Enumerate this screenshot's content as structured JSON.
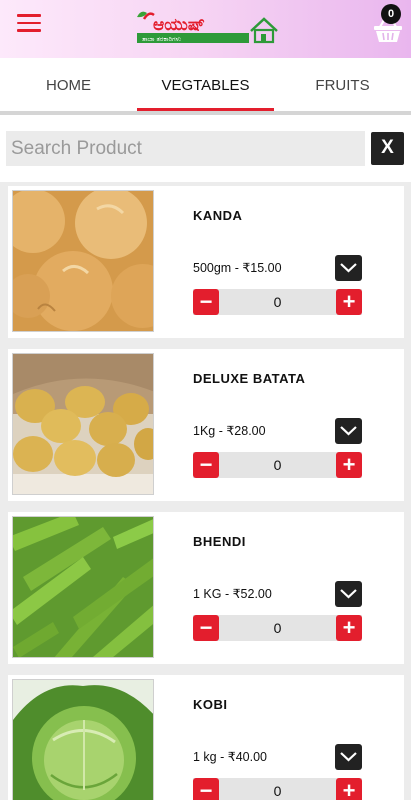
{
  "header": {
    "cart_count": "0",
    "logo_text": "ಆಯುಷ್",
    "logo_tagline": "ತಾಜಾ ತರಕಾರಿಗಳು"
  },
  "tabs": [
    {
      "label": "HOME"
    },
    {
      "label": "VEGTABLES"
    },
    {
      "label": "FRUITS"
    }
  ],
  "search": {
    "placeholder": "Search Product",
    "value": "",
    "clear_label": "X"
  },
  "products": [
    {
      "name": "KANDA",
      "price": "500gm - ₹15.00",
      "qty": "0",
      "image": "onion"
    },
    {
      "name": "DELUXE BATATA",
      "price": "1Kg - ₹28.00",
      "qty": "0",
      "image": "potato"
    },
    {
      "name": "BHENDI",
      "price": "1 KG - ₹52.00",
      "qty": "0",
      "image": "okra"
    },
    {
      "name": "KOBI",
      "price": "1 kg - ₹40.00",
      "qty": "0",
      "image": "cabbage"
    }
  ],
  "colors": {
    "accent": "#e31e2d",
    "header_start": "#fde9fb",
    "header_end": "#e9b6ee"
  }
}
